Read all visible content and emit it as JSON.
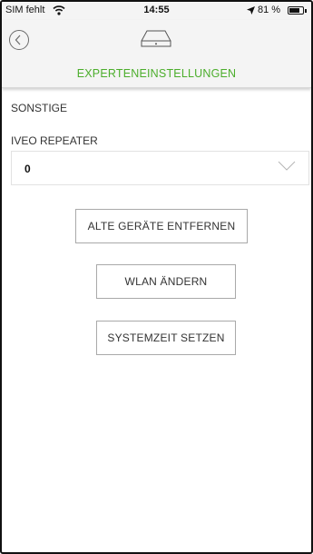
{
  "status_bar": {
    "carrier": "SIM fehlt",
    "time": "14:55",
    "battery_text": "81 %",
    "battery_level": 0.81,
    "icons": [
      "wifi-icon",
      "location-arrow-icon",
      "battery-icon"
    ]
  },
  "header": {
    "title": "EXPERTENEINSTELLUNGEN",
    "back_icon": "chevron-left-circle-icon",
    "device_icon": "device-hub-icon"
  },
  "section": {
    "title": "SONSTIGE"
  },
  "repeater": {
    "label": "IVEO REPEATER",
    "value": "0",
    "chevron_icon": "chevron-down-icon"
  },
  "buttons": {
    "remove_devices": "ALTE GERÄTE ENTFERNEN",
    "change_wlan": "WLAN ÄNDERN",
    "set_system_time": "SYSTEMZEIT SETZEN"
  },
  "colors": {
    "accent": "#4cae2c",
    "header_bg": "#f4f4f4",
    "text": "#333333",
    "border": "#a9a9a9"
  }
}
